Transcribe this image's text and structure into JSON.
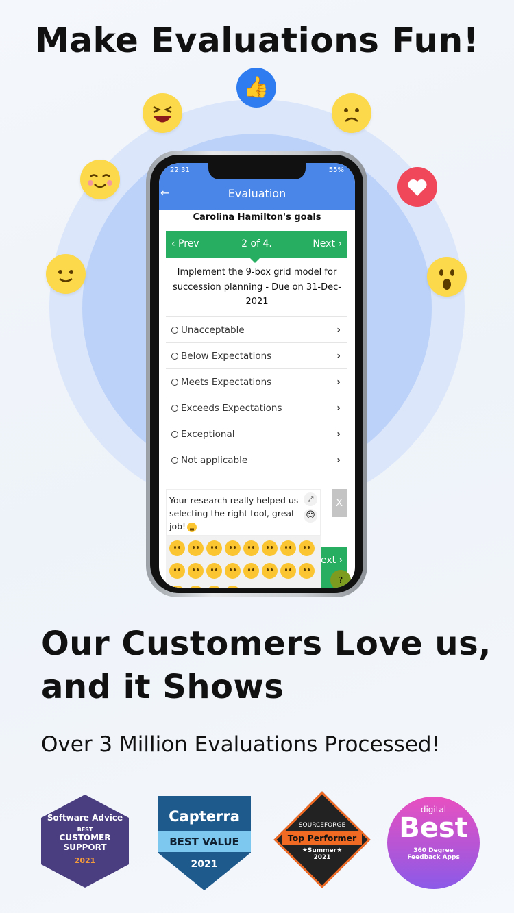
{
  "headline": "Make Evaluations Fun!",
  "colors": {
    "brand_blue": "#4a86e8",
    "green": "#27ae60",
    "circle_outer": "#dbe6fb",
    "circle_inner": "#b8cff7",
    "heart": "#f0475b"
  },
  "floating_icons": [
    "thumbs-up-icon",
    "laughing-face-icon",
    "sad-face-icon",
    "blushing-face-icon",
    "heart-icon",
    "smiling-face-icon",
    "shocked-face-icon"
  ],
  "phone": {
    "status": {
      "time": "22:31",
      "battery": "55%"
    },
    "header": {
      "title": "Evaluation",
      "back": "←"
    },
    "employee_title": "Carolina Hamilton's goals",
    "pager": {
      "prev": "‹ Prev",
      "position": "2 of 4.",
      "next": "Next ›"
    },
    "goal": "Implement the 9-box grid model for succession planning - Due on 31-Dec-2021",
    "options": [
      "Unacceptable",
      "Below Expectations",
      "Meets Expectations",
      "Exceeds Expectations",
      "Exceptional",
      "Not applicable"
    ],
    "comment": "Your research really helped us selecting the right tool, great job!",
    "close": "X",
    "next_partial": "ext ›",
    "help": "?"
  },
  "section2": {
    "title_line1": "Our Customers Love us,",
    "title_line2": "and it Shows",
    "subtitle": "Over 3 Million Evaluations Processed!"
  },
  "badges": [
    {
      "brand": "Software Advice",
      "l1": "BEST",
      "l2": "CUSTOMER",
      "l3": "SUPPORT",
      "year": "2021"
    },
    {
      "brand": "Capterra",
      "award": "BEST VALUE",
      "year": "2021"
    },
    {
      "brand": "SOURCEFORGE",
      "award": "Top Performer",
      "season": "★Summer★",
      "year": "2021"
    },
    {
      "top": "digital",
      "award": "Best",
      "l1": "360 Degree",
      "l2": "Feedback Apps"
    }
  ]
}
